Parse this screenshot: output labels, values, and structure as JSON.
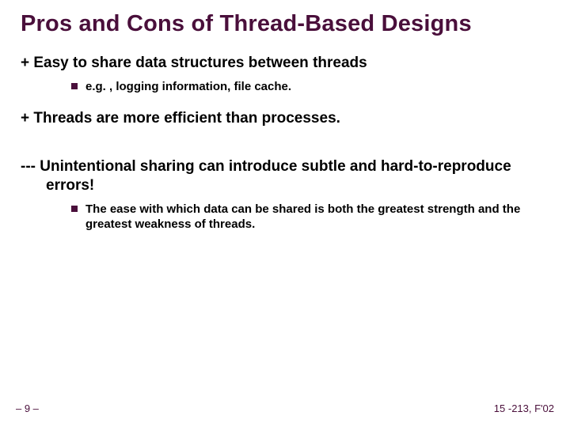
{
  "title": "Pros and Cons of Thread-Based Designs",
  "points": [
    {
      "prefix": "+ ",
      "text": "Easy to share data structures between threads",
      "sub": "e.g. , logging information, file cache."
    },
    {
      "prefix": "+ ",
      "text": "Threads are more efficient than processes."
    },
    {
      "prefix": "--- ",
      "text": "Unintentional sharing can introduce subtle and hard-to-reproduce errors!",
      "sub": "The ease with which data can be shared is both the greatest strength and the greatest weakness of threads."
    }
  ],
  "footer": {
    "left": "– 9 –",
    "right": "15 -213, F'02"
  }
}
